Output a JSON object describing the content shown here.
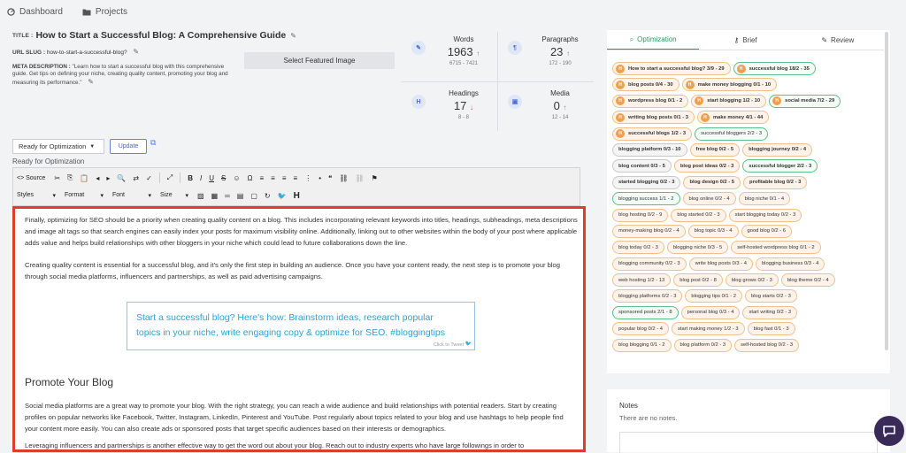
{
  "nav": {
    "dashboard": "Dashboard",
    "projects": "Projects"
  },
  "post": {
    "title_label": "TITLE :",
    "title": "How to Start a Successful Blog: A Comprehensive Guide",
    "slug_label": "URL SLUG :",
    "slug": "how-to-start-a-successful-blog?",
    "meta_label": "META DESCRIPTION :",
    "meta": "\"Learn how to start a successful blog with this comprehensive guide. Get tips on defining your niche, creating quality content, promoting your blog and measuring its performance.\"",
    "featured_button": "Select Featured Image"
  },
  "stats": {
    "words": {
      "label": "Words",
      "value": "1963",
      "range": "6715 - 7421"
    },
    "paragraphs": {
      "label": "Paragraphs",
      "value": "23",
      "range": "172 - 190"
    },
    "headings": {
      "label": "Headings",
      "value": "17",
      "range": "8 - 8"
    },
    "media": {
      "label": "Media",
      "value": "0",
      "range": "12 - 14"
    }
  },
  "status": {
    "select": "Ready for Optimization",
    "update": "Update",
    "label": "Ready for Optimization"
  },
  "toolbar": {
    "source": "Source",
    "styles": "Styles",
    "format": "Format",
    "font": "Font",
    "size": "Size"
  },
  "editor": {
    "p1": "Finally, optimizing for SEO should be a priority when creating quality content on a blog. This includes incorporating relevant keywords into titles, headings, subheadings, meta descriptions and image alt tags so that search engines can easily index your posts for maximum visibility online. Additionally, linking out to other websites within the body of your post where applicable adds value and helps build relationships with other bloggers in your niche which could lead to future collaborations down the line.",
    "p2": "Creating quality content is essential for a successful blog, and it's only the first step in building an audience. Once you have your content ready, the next step is to promote your blog through social media platforms, influencers and partnerships, as well as paid advertising campaigns.",
    "tweet": "Start a successful blog? Here's how: Brainstorm ideas, research popular topics in your niche, write engaging copy & optimize for SEO. #bloggingtips",
    "click_to_tweet": "Click to Tweet",
    "heading": "Promote Your Blog",
    "p3": "Social media platforms are a great way to promote your blog. With the right strategy, you can reach a wide audience and build relationships with potential readers. Start by creating profiles on popular networks like Facebook, Twitter, Instagram, LinkedIn, Pinterest and YouTube. Post regularly about topics related to your blog and use hashtags to help people find your content more easily. You can also create ads or sponsored posts that target specific audiences based on their interests or demographics.",
    "p4": "Leveraging influencers and partnerships is another effective way to get the word out about your blog. Reach out to industry experts who have large followings in order to"
  },
  "tabs": {
    "optimization": "Optimization",
    "brief": "Brief",
    "review": "Review"
  },
  "keywords": [
    [
      {
        "t": "How to start a successful blog? 3/9 - 29",
        "h": true,
        "s": "o"
      },
      {
        "t": "successful blog 18/2 - 35",
        "h": true,
        "s": "g"
      }
    ],
    [
      {
        "t": "blog posts 0/4 - 30",
        "h": true,
        "s": "o"
      },
      {
        "t": "make money blogging 0/1 - 10",
        "h": true,
        "s": "o"
      }
    ],
    [
      {
        "t": "wordpress blog 0/1 - 2",
        "h": true,
        "s": "o"
      },
      {
        "t": "start blogging 1/2 - 10",
        "h": true,
        "s": "o"
      },
      {
        "t": "social media 7/2 - 29",
        "h": true,
        "s": "g"
      }
    ],
    [
      {
        "t": "writing blog posts 0/1 - 3",
        "h": true,
        "s": "o"
      },
      {
        "t": "make money 4/1 - 44",
        "h": true,
        "s": "o"
      }
    ],
    [
      {
        "t": "successful blogs 1/2 - 3",
        "h": true,
        "s": "o"
      },
      {
        "t": "successful bloggers 2/2 - 3",
        "h": false,
        "s": "g"
      }
    ],
    [
      {
        "t": "blogging platform 0/3 - 10",
        "h": false,
        "s": "x",
        "b": true
      },
      {
        "t": "free blog 0/2 - 5",
        "h": false,
        "s": "o",
        "b": true
      },
      {
        "t": "blogging journey 0/2 - 4",
        "h": false,
        "s": "o",
        "b": true
      }
    ],
    [
      {
        "t": "blog content 0/3 - 5",
        "h": false,
        "s": "x",
        "b": true
      },
      {
        "t": "blog post ideas 0/2 - 3",
        "h": false,
        "s": "o",
        "b": true
      },
      {
        "t": "successful blogger 2/2 - 3",
        "h": false,
        "s": "g",
        "b": true
      }
    ],
    [
      {
        "t": "started blogging 0/2 - 3",
        "h": false,
        "s": "x",
        "b": true
      },
      {
        "t": "blog design 0/2 - 5",
        "h": false,
        "s": "o",
        "b": true
      },
      {
        "t": "profitable blog 0/2 - 3",
        "h": false,
        "s": "o",
        "b": true
      }
    ],
    [
      {
        "t": "blogging success 1/1 - 2",
        "h": false,
        "s": "g"
      },
      {
        "t": "blog online 0/2 - 4",
        "h": false,
        "s": "o"
      },
      {
        "t": "blog niche 0/1 - 4",
        "h": false,
        "s": "o"
      }
    ],
    [
      {
        "t": "blog hosting 0/2 - 9",
        "h": false,
        "s": "o"
      },
      {
        "t": "blog started 0/2 - 3",
        "h": false,
        "s": "o"
      },
      {
        "t": "start blogging today 0/2 - 3",
        "h": false,
        "s": "o"
      }
    ],
    [
      {
        "t": "money-making blog 0/2 - 4",
        "h": false,
        "s": "o"
      },
      {
        "t": "blog topic 0/3 - 4",
        "h": false,
        "s": "o"
      },
      {
        "t": "good blog 0/2 - 6",
        "h": false,
        "s": "o"
      }
    ],
    [
      {
        "t": "blog today 0/2 - 3",
        "h": false,
        "s": "o"
      },
      {
        "t": "blogging niche 0/3 - 5",
        "h": false,
        "s": "o"
      },
      {
        "t": "self-hosted wordpress blog 0/1 - 2",
        "h": false,
        "s": "o"
      }
    ],
    [
      {
        "t": "blogging community 0/2 - 3",
        "h": false,
        "s": "o"
      },
      {
        "t": "write blog posts 0/3 - 4",
        "h": false,
        "s": "o"
      },
      {
        "t": "blogging business 0/3 - 4",
        "h": false,
        "s": "o"
      }
    ],
    [
      {
        "t": "web hosting 1/2 - 13",
        "h": false,
        "s": "o"
      },
      {
        "t": "blog post 0/2 - 8",
        "h": false,
        "s": "o"
      },
      {
        "t": "blog grows 0/2 - 3",
        "h": false,
        "s": "o"
      },
      {
        "t": "blog theme 0/2 - 4",
        "h": false,
        "s": "o"
      }
    ],
    [
      {
        "t": "blogging platforms 0/2 - 3",
        "h": false,
        "s": "o"
      },
      {
        "t": "blogging tips 0/1 - 2",
        "h": false,
        "s": "o"
      },
      {
        "t": "blog starts 0/2 - 3",
        "h": false,
        "s": "o"
      }
    ],
    [
      {
        "t": "sponsored posts 2/1 - 8",
        "h": false,
        "s": "g"
      },
      {
        "t": "personal blog 0/3 - 4",
        "h": false,
        "s": "o"
      },
      {
        "t": "start writing 0/2 - 3",
        "h": false,
        "s": "o"
      }
    ],
    [
      {
        "t": "popular blog 0/2 - 4",
        "h": false,
        "s": "o"
      },
      {
        "t": "start making money 1/2 - 3",
        "h": false,
        "s": "o"
      },
      {
        "t": "blog fast 0/1 - 3",
        "h": false,
        "s": "o"
      }
    ],
    [
      {
        "t": "blog blogging 0/1 - 2",
        "h": false,
        "s": "o"
      },
      {
        "t": "blog platform 0/2 - 3",
        "h": false,
        "s": "o"
      },
      {
        "t": "self-hosted blog 0/2 - 3",
        "h": false,
        "s": "o"
      }
    ]
  ],
  "notes": {
    "title": "Notes",
    "empty": "There are no notes."
  },
  "colors": {
    "accent_green": "#2f9a60",
    "orange_badge": "#f0a04a",
    "editor_border": "#e03b2c",
    "tweet_blue": "#27a3d6"
  }
}
